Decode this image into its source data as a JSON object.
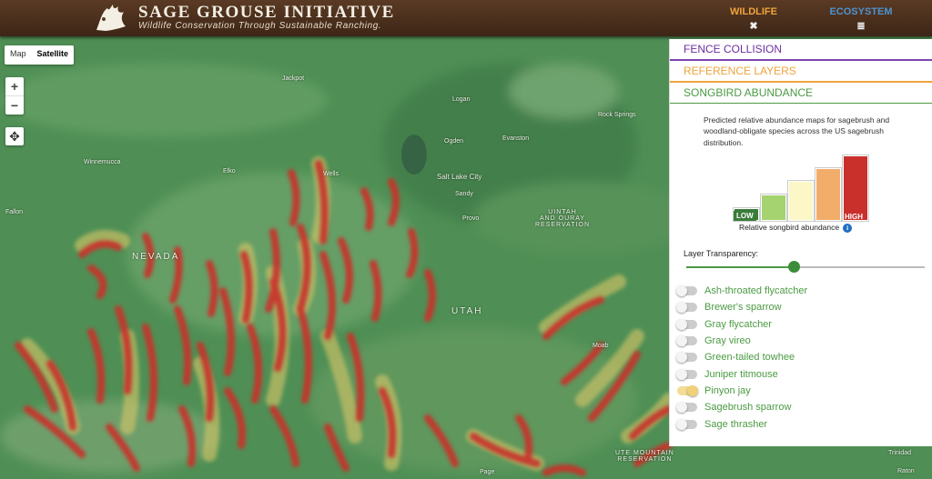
{
  "header": {
    "title": "SAGE GROUSE INITIATIVE",
    "tagline": "Wildlife Conservation Through Sustainable Ranching.",
    "nav": [
      {
        "label": "WILDLIFE",
        "glyph": "✖"
      },
      {
        "label": "ECOSYSTEM",
        "glyph": "≣"
      }
    ]
  },
  "map": {
    "type_control": [
      "Map",
      "Satellite"
    ],
    "active_type": "Satellite",
    "zoom_in": "+",
    "zoom_out": "−",
    "locate_glyph": "✥",
    "labels": {
      "nevada": "NEVADA",
      "utah": "UTAH",
      "salt_lake_city": "Salt Lake City",
      "ogden": "Ogden",
      "logan": "Logan",
      "provo": "Provo",
      "sandy": "Sandy",
      "evanston": "Evanston",
      "rock_springs": "Rock Springs",
      "uintah": "UINTAH\nAND OURAY\nRESERVATION",
      "ute": "UTE MOUNTAIN\nRESERVATION",
      "jackpot": "Jackpot",
      "elko": "Elko",
      "wells": "Wells",
      "winnemucca": "Winnemucca",
      "fallon": "Fallon",
      "moab": "Moab",
      "trinidad": "Trinidad",
      "raton": "Raton",
      "page": "Page"
    }
  },
  "panel": {
    "sections": [
      {
        "label": "FENCE COLLISION",
        "color": "#6b2fa0"
      },
      {
        "label": "REFERENCE LAYERS",
        "color": "#f0a33c"
      },
      {
        "label": "SONGBIRD ABUNDANCE",
        "color": "#4b9a42"
      }
    ],
    "description": "Predicted relative abundance maps for sagebrush and woodland-obligate species across the US sagebrush distribution.",
    "legend": {
      "low": "LOW",
      "high": "HIGH",
      "caption": "Relative songbird abundance",
      "colors": [
        "#3a7c3a",
        "#a5d36f",
        "#fbf7c7",
        "#f2ad6b",
        "#c9302c"
      ]
    },
    "transparency_label": "Layer Transparency:",
    "transparency_value": 0.45,
    "species": [
      {
        "name": "Ash-throated flycatcher",
        "on": false
      },
      {
        "name": "Brewer's sparrow",
        "on": false
      },
      {
        "name": "Gray flycatcher",
        "on": false
      },
      {
        "name": "Gray vireo",
        "on": false
      },
      {
        "name": "Green-tailed towhee",
        "on": false
      },
      {
        "name": "Juniper titmouse",
        "on": false
      },
      {
        "name": "Pinyon jay",
        "on": true
      },
      {
        "name": "Sagebrush sparrow",
        "on": false
      },
      {
        "name": "Sage thrasher",
        "on": false
      }
    ]
  }
}
